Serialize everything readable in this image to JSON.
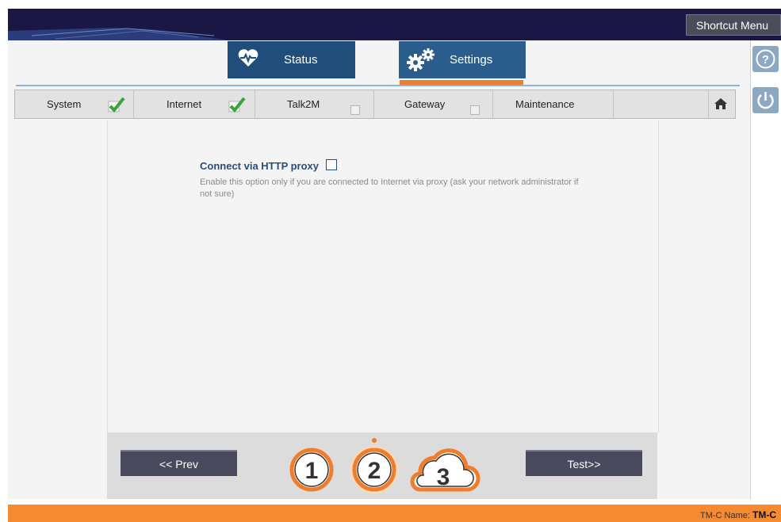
{
  "header": {
    "shortcut_menu": "Shortcut Menu"
  },
  "tabs": {
    "status": "Status",
    "settings": "Settings"
  },
  "steps": [
    {
      "label": "System",
      "done": true
    },
    {
      "label": "Internet",
      "done": true
    },
    {
      "label": "Talk2M",
      "done": false
    },
    {
      "label": "Gateway",
      "done": false
    },
    {
      "label": "Maintenance"
    }
  ],
  "icons": {
    "help": "help-icon",
    "power": "power-icon",
    "home": "home-icon",
    "status": "heartbeat-icon",
    "settings": "gears-icon"
  },
  "form": {
    "proxy_label": "Connect via HTTP proxy",
    "proxy_checked": false,
    "proxy_help": "Enable this option only if you are connected to Internet via proxy (ask your network administrator if not sure)"
  },
  "wizard": {
    "prev": "<< Prev",
    "next": "Test>>",
    "steps": [
      "1",
      "2",
      "3"
    ],
    "current_step": "2"
  },
  "footer": {
    "name_label": "TM-C Name:",
    "name_value": "TM-C"
  },
  "colors": {
    "accent": "#f58a30",
    "tab_blue": "#1f4e7a",
    "header": "#1a1745"
  }
}
